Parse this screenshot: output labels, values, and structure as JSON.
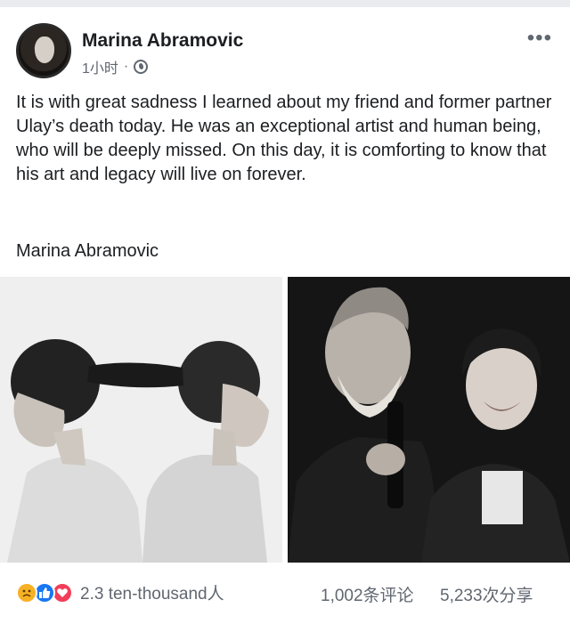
{
  "post": {
    "author": "Marina Abramovic",
    "timestamp": "1小时",
    "separator": "·",
    "text": "It is with great sadness I learned about my friend and former partner Ulay’s death today. He was an exceptional artist and human being, who will be deeply missed. On this day, it is comforting to know that his art and legacy will live on forever.",
    "signature": "Marina Abramovic",
    "more_label": "•••"
  },
  "footer": {
    "reactions_count": "2.3 ten-thousand人",
    "comments_count": "1,002条评论",
    "shares_count": "5,233次分享"
  },
  "colors": {
    "text": "#1c1e21",
    "secondary": "#606770",
    "like_blue": "#1877f2",
    "love_red": "#f33e58",
    "sad_yellow": "#f7b125"
  },
  "icons": [
    "globe-icon",
    "more-icon",
    "sad-reaction-icon",
    "like-reaction-icon",
    "love-reaction-icon"
  ]
}
